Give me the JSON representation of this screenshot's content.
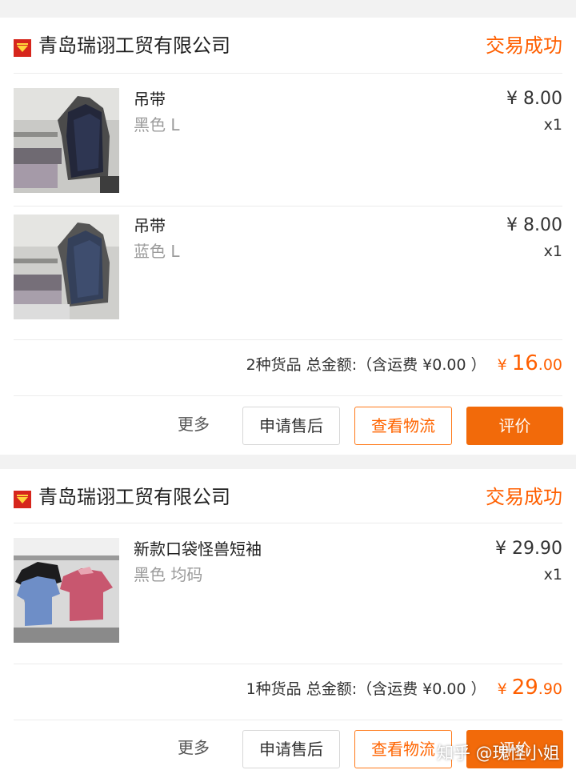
{
  "orders": [
    {
      "shop_name": "青岛瑞诩工贸有限公司",
      "status": "交易成功",
      "items": [
        {
          "name": "吊带",
          "variant": "黑色 L",
          "price": "¥ 8.00",
          "qty": "x1",
          "thumbnail": "product-photo-dark-camisole"
        },
        {
          "name": "吊带",
          "variant": "蓝色 L",
          "price": "¥ 8.00",
          "qty": "x1",
          "thumbnail": "product-photo-blue-camisole"
        }
      ],
      "summary": "2种货品 总金额:（含运费 ¥0.00 ）",
      "total": {
        "currency": "¥",
        "integer": "16",
        "decimal": ".00"
      },
      "actions": {
        "more": "更多",
        "after_sale": "申请售后",
        "logistics": "查看物流",
        "review": "评价"
      }
    },
    {
      "shop_name": "青岛瑞诩工贸有限公司",
      "status": "交易成功",
      "items": [
        {
          "name": "新款口袋怪兽短袖",
          "variant": "黑色 均码",
          "price": "¥ 29.90",
          "qty": "x1",
          "thumbnail": "product-photo-tshirts"
        }
      ],
      "summary": "1种货品 总金额:（含运费 ¥0.00 ）",
      "total": {
        "currency": "¥",
        "integer": "29",
        "decimal": ".90"
      },
      "actions": {
        "more": "更多",
        "after_sale": "申请售后",
        "logistics": "查看物流",
        "review": "评价"
      }
    }
  ],
  "watermark": "知乎 @瑰怪小姐",
  "colors": {
    "accent": "#ff5f00",
    "review_button": "#f26a0a",
    "shop_icon": "#d6261c",
    "background": "#f2f2f2"
  }
}
